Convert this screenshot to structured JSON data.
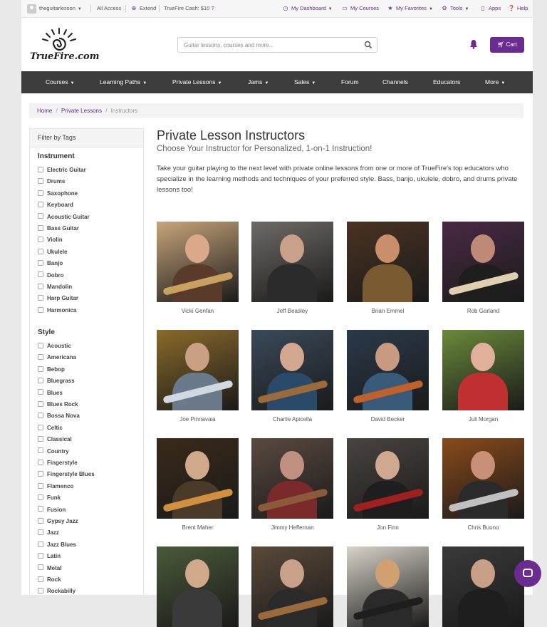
{
  "utility": {
    "username": "theguitarlesson",
    "all_access": "All Access",
    "extend": "Extend",
    "cash": "TrueFire Cash: $10",
    "dashboard": "My Dashboard",
    "courses": "My Courses",
    "favorites": "My Favorites",
    "tools": "Tools",
    "apps": "Apps",
    "help": "Help"
  },
  "header": {
    "logo_text": "TrueFire.com",
    "search_placeholder": "Guitar lessons, courses and more...",
    "cart_label": "Cart"
  },
  "nav": {
    "items": [
      {
        "label": "Courses",
        "dropdown": true
      },
      {
        "label": "Learning Paths",
        "dropdown": true
      },
      {
        "label": "Private Lessons",
        "dropdown": true
      },
      {
        "label": "Jams",
        "dropdown": true
      },
      {
        "label": "Sales",
        "dropdown": true
      },
      {
        "label": "Forum",
        "dropdown": false
      },
      {
        "label": "Channels",
        "dropdown": false
      },
      {
        "label": "Educators",
        "dropdown": false
      },
      {
        "label": "More",
        "dropdown": true
      }
    ]
  },
  "breadcrumb": {
    "home": "Home",
    "private_lessons": "Private Lessons",
    "current": "Instructors",
    "separator": "/"
  },
  "filters": {
    "title": "Filter by Tags",
    "instrument_title": "Instrument",
    "instruments": [
      "Electric Guitar",
      "Drums",
      "Saxophone",
      "Keyboard",
      "Acoustic Guitar",
      "Bass Guitar",
      "Violin",
      "Ukulele",
      "Banjo",
      "Dobro",
      "Mandolin",
      "Harp Guitar",
      "Harmonica"
    ],
    "style_title": "Style",
    "styles": [
      "Acoustic",
      "Americana",
      "Bebop",
      "Bluegrass",
      "Blues",
      "Blues Rock",
      "Bossa Nova",
      "Celtic",
      "Classical",
      "Country",
      "Fingerstyle",
      "Fingerstyle Blues",
      "Flamenco",
      "Funk",
      "Fusion",
      "Gypsy Jazz",
      "Jazz",
      "Jazz Blues",
      "Latin",
      "Metal",
      "Rock",
      "Rockabilly"
    ]
  },
  "main": {
    "title": "Private Lesson Instructors",
    "subtitle": "Choose Your Instructor for Personalized, 1-on-1 Instruction!",
    "intro": "Take your guitar playing to the next level with private online lessons from one or more of TrueFire's top educators who specialize in the learning methods and techniques of your preferred style. Bass, banjo, ukulele, dobro, and drums private lessons too!"
  },
  "instructors": [
    {
      "name": "Vicki Genfan",
      "bg": "#c7a57a",
      "skin": "#d9a98a",
      "shirt": "#5a3a2a",
      "inst": "#c8a060"
    },
    {
      "name": "Jeff Beasley",
      "bg": "#6f6a66",
      "skin": "#c9a08a",
      "shirt": "#2b2b2b",
      "inst": ""
    },
    {
      "name": "Brian Emmel",
      "bg": "#4a3322",
      "skin": "#c98f6a",
      "shirt": "#7a5a30",
      "inst": ""
    },
    {
      "name": "Rob Garland",
      "bg": "#4a2a44",
      "skin": "#c08a78",
      "shirt": "#1e1e1e",
      "inst": "#e0d0b0"
    },
    {
      "name": "Joe Pinnavaia",
      "bg": "#8a6a2a",
      "skin": "#caa085",
      "shirt": "#6a7a8a",
      "inst": "#d0d8e0"
    },
    {
      "name": "Charlie Apicella",
      "bg": "#3a4a5a",
      "skin": "#d4a890",
      "shirt": "#2a4a6a",
      "inst": "#9a6a3a"
    },
    {
      "name": "David Becker",
      "bg": "#2a3a4a",
      "skin": "#c89a80",
      "shirt": "#3a5a7a",
      "inst": "#c0602a"
    },
    {
      "name": "Juli Morgan",
      "bg": "#6a8a3a",
      "skin": "#e0b09a",
      "shirt": "#c03030",
      "inst": ""
    },
    {
      "name": "Brent Maher",
      "bg": "#3a2a1a",
      "skin": "#d0a88a",
      "shirt": "#4a3a2a",
      "inst": "#d09040"
    },
    {
      "name": "Jimmy Heffernan",
      "bg": "#5a4a40",
      "skin": "#c09080",
      "shirt": "#7a2a2a",
      "inst": "#8a5a3a"
    },
    {
      "name": "Jon Finn",
      "bg": "#4a4440",
      "skin": "#d0a890",
      "shirt": "#1e1e1e",
      "inst": "#a02020"
    },
    {
      "name": "Chris Buono",
      "bg": "#8a4a1a",
      "skin": "#c89078",
      "shirt": "#2a2a2a",
      "inst": "#c0c0c0"
    },
    {
      "name": "",
      "bg": "#4a5a3a",
      "skin": "#d0a88a",
      "shirt": "#3a3a3a",
      "inst": ""
    },
    {
      "name": "",
      "bg": "#5a4a3a",
      "skin": "#c9a08a",
      "shirt": "#2a2a2a",
      "inst": "#9a6a3a"
    },
    {
      "name": "",
      "bg": "#d8d2c8",
      "skin": "#d0a070",
      "shirt": "#2a2a2a",
      "inst": "#1e1e1e"
    },
    {
      "name": "",
      "bg": "#3a3a3a",
      "skin": "#c8a088",
      "shirt": "#1e1e1e",
      "inst": ""
    }
  ],
  "colors": {
    "accent": "#6a2c91",
    "nav_bg": "#3c3c3c"
  }
}
